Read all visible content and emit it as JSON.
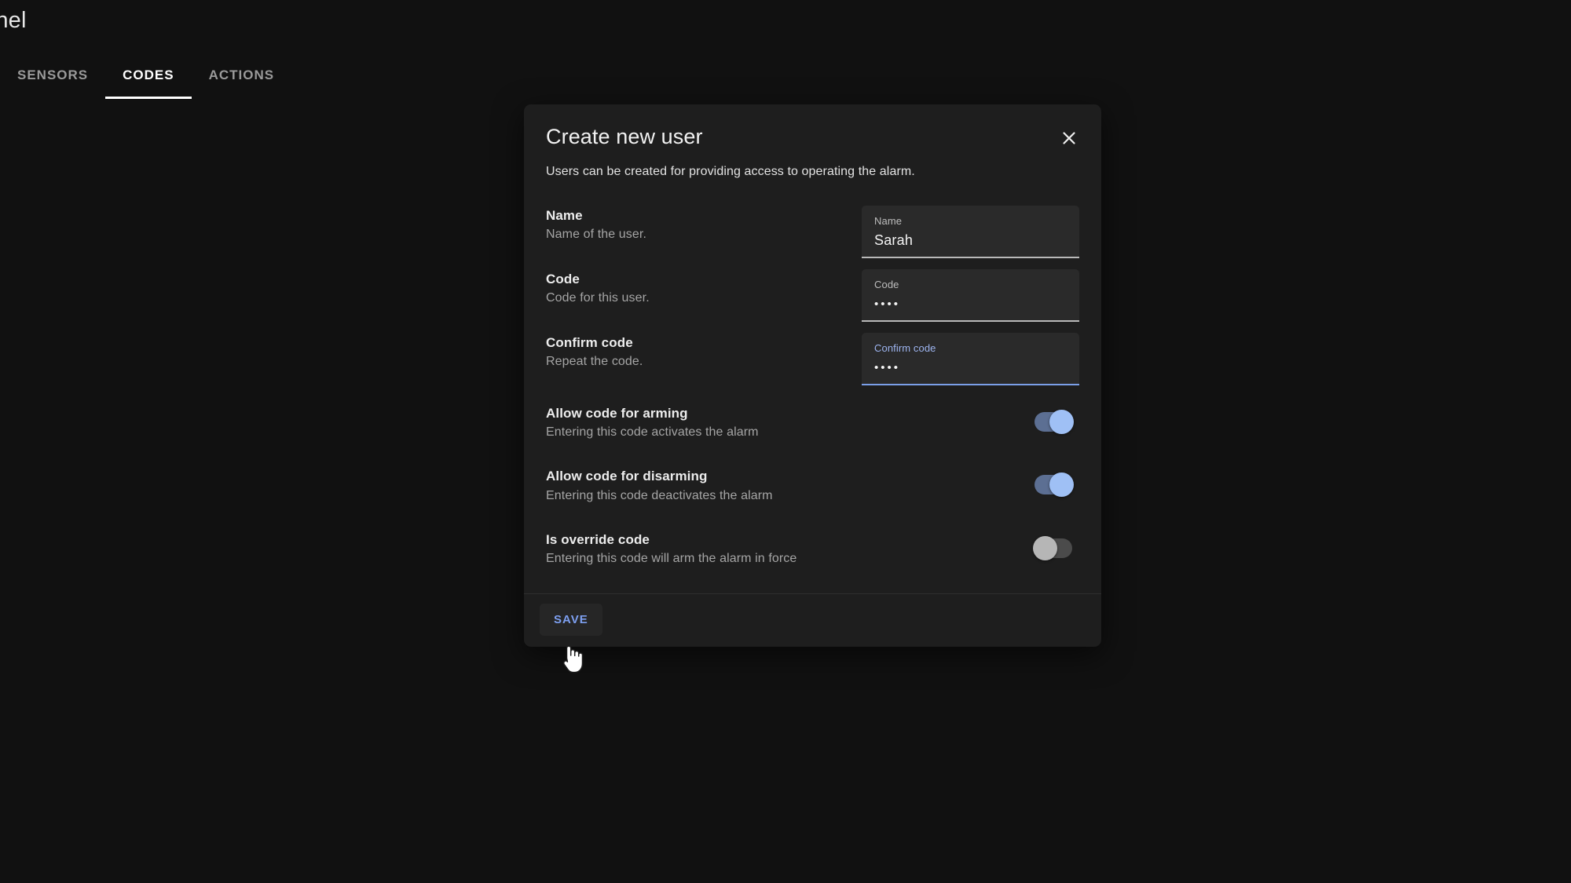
{
  "app": {
    "title": "anel"
  },
  "tabs": [
    {
      "label": "SENSORS",
      "active": false
    },
    {
      "label": "CODES",
      "active": true
    },
    {
      "label": "ACTIONS",
      "active": false
    }
  ],
  "dialog": {
    "title": "Create new user",
    "subtitle": "Users can be created for providing access to operating the alarm.",
    "close_icon": "close-icon",
    "fields": [
      {
        "label": "Name",
        "description": "Name of the user.",
        "input_label": "Name",
        "value": "Sarah",
        "masked": false,
        "focused": false
      },
      {
        "label": "Code",
        "description": "Code for this user.",
        "input_label": "Code",
        "value": "••••",
        "masked": true,
        "focused": false
      },
      {
        "label": "Confirm code",
        "description": "Repeat the code.",
        "input_label": "Confirm code",
        "value": "••••",
        "masked": true,
        "focused": true
      }
    ],
    "toggles": [
      {
        "label": "Allow code for arming",
        "description": "Entering this code activates the alarm",
        "state": "on"
      },
      {
        "label": "Allow code for disarming",
        "description": "Entering this code deactivates the alarm",
        "state": "on"
      },
      {
        "label": "Is override code",
        "description": "Entering this code will arm the alarm in force",
        "state": "off"
      }
    ],
    "save_label": "SAVE"
  },
  "colors": {
    "page_background": "#111111",
    "dialog_background": "#1e1e1e",
    "field_background": "#2a2a2a",
    "accent_blue": "#7d9ff0",
    "focus_underline": "#7b9fe8",
    "switch_on_track": "#5c6f93",
    "switch_on_knob": "#9fc0f5",
    "switch_off_track": "#4b4b4b",
    "switch_off_knob": "#b6b6b6",
    "tab_active": "#ffffff",
    "tab_inactive": "#9a9a9a"
  },
  "cursor": {
    "type": "pointer-hand-cursor"
  }
}
